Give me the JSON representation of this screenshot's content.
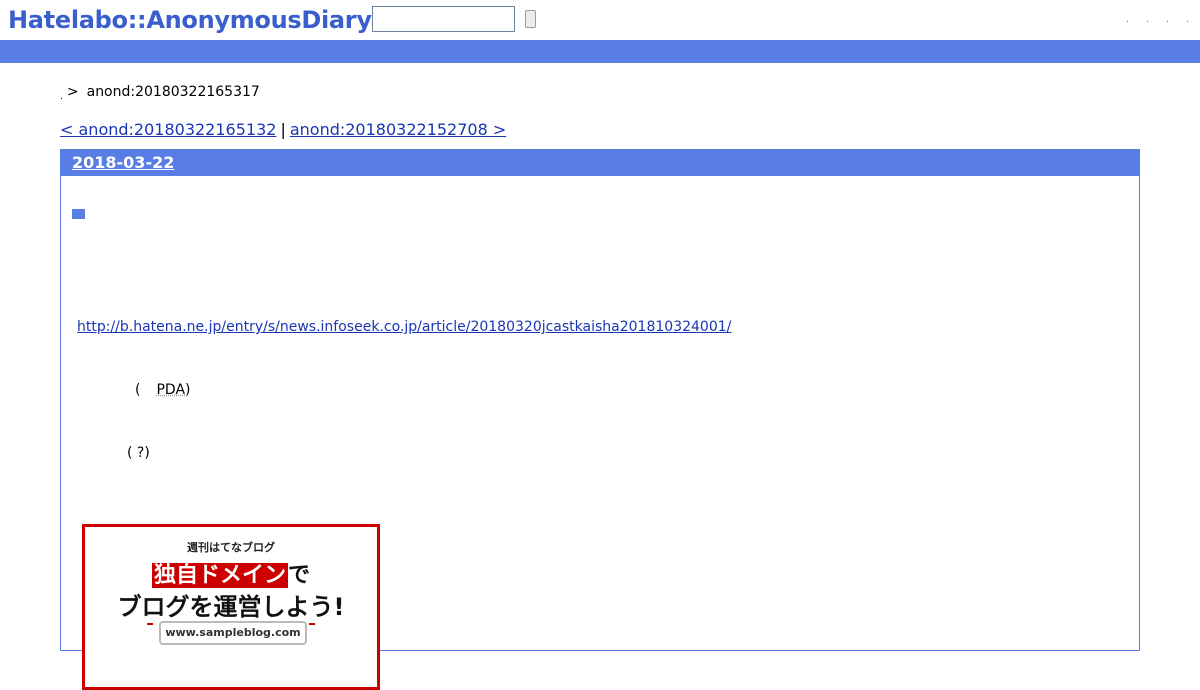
{
  "header": {
    "logo": "Hatelabo::AnonymousDiary",
    "search": {
      "value": "",
      "placeholder": ""
    },
    "search_button_label": "",
    "links": [
      ".",
      ".",
      ".",
      "."
    ]
  },
  "breadcrumb": {
    "home": ".",
    "separator": ">",
    "current": "anond:20180322165317"
  },
  "pager": {
    "prev": "< anond:20180322165132",
    "separator": "|",
    "next": "anond:20180322152708 >"
  },
  "entry": {
    "date": "2018-03-22",
    "mark": "■",
    "link": "http://b.hatena.ne.jp/entry/s/news.infoseek.co.jp/article/20180320jcastkaisha201810324001/",
    "line1": {
      "open": "(",
      "keyword": "PDA",
      "close": ")"
    },
    "line2": "(  ?)"
  },
  "ad": {
    "line1": "週刊はてなブログ",
    "line2_highlight": "独自ドメイン",
    "line2_rest": "で",
    "line3": "ブログを運営しよう!",
    "url": "www.sampleblog.com"
  },
  "colors": {
    "brand": "#3a5fcd",
    "bar": "#587ee5",
    "link": "#1a35b5",
    "ad_border": "#cc0000"
  }
}
